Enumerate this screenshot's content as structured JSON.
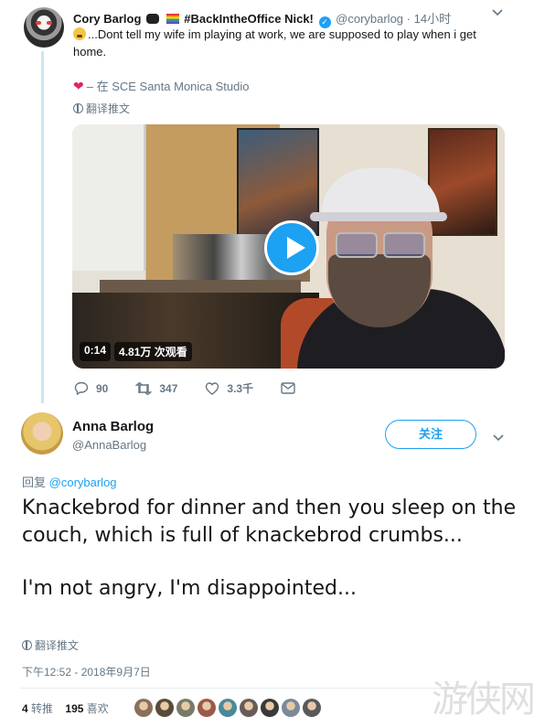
{
  "tweet1": {
    "name": "Cory Barlog",
    "hashtag": "#BackIntheOffice Nick!",
    "handle": "@corybarlog",
    "time": "· 14小时",
    "text": "...Dont tell my wife im playing at work, we are supposed to play when i get home.",
    "location": "– 在 SCE Santa Monica Studio",
    "translate_label": "翻译推文",
    "video": {
      "duration": "0:14",
      "views": "4.81万 次观看"
    },
    "actions": {
      "replies": "90",
      "retweets": "347",
      "likes": "3.3千"
    }
  },
  "tweet2": {
    "name": "Anna Barlog",
    "handle": "@AnnaBarlog",
    "follow_label": "关注",
    "reply_prefix": "回复",
    "reply_to": "@corybarlog",
    "text_line1": "Knackebrod for dinner and then you sleep on the couch, which is full of knackebrod crumbs...",
    "text_line2": "I'm not angry, I'm disappointed...",
    "translate_label": "翻译推文",
    "timestamp": "下午12:52 - 2018年9月7日",
    "retweet_count": "4",
    "retweet_label": "转推",
    "like_count": "195",
    "like_label": "喜欢",
    "liker_colors": [
      "#8a6f5a",
      "#5a4a3a",
      "#7a7a6a",
      "#9a5a4a",
      "#4a8a9a",
      "#6a5a5a",
      "#3a3a3a",
      "#7a8a9a",
      "#5a5a5a"
    ]
  },
  "watermark": "游侠网"
}
